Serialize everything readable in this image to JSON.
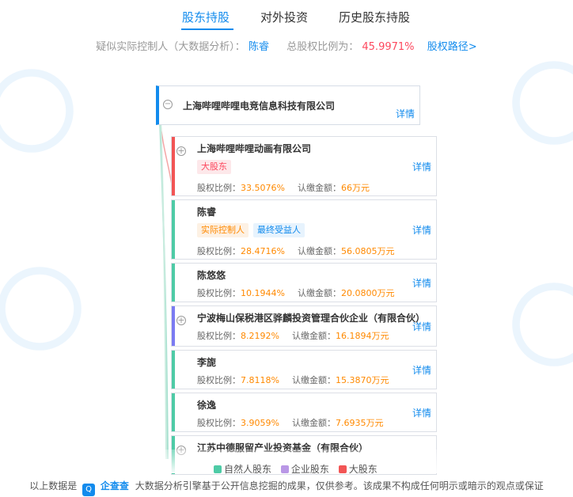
{
  "tabs": [
    {
      "label": "股东持股",
      "active": true
    },
    {
      "label": "对外投资",
      "active": false
    },
    {
      "label": "历史股东持股",
      "active": false
    }
  ],
  "summary": {
    "prefix": "疑似实际控制人（大数据分析）：",
    "controller": "陈睿",
    "ratio_label": "总股权比例为：",
    "ratio_value": "45.9971%",
    "path_label": "股权路径>"
  },
  "root": {
    "name": "上海哔哩哔哩电竞信息科技有限公司",
    "toggle": "−",
    "detail": "详情"
  },
  "labels": {
    "ratio": "股权比例：",
    "amount": "认缴金额：",
    "detail": "详情"
  },
  "shareholders": [
    {
      "name": "上海哔哩哔哩动画有限公司",
      "type": "big",
      "tags": [
        "大股东"
      ],
      "ratio": "33.5076%",
      "amount": "66万元",
      "toggle": "+"
    },
    {
      "name": "陈睿",
      "type": "natural",
      "tags": [
        "实际控制人",
        "最终受益人"
      ],
      "ratio": "28.4716%",
      "amount": "56.0805万元"
    },
    {
      "name": "陈悠悠",
      "type": "natural",
      "tags": [],
      "ratio": "10.1944%",
      "amount": "20.0800万元"
    },
    {
      "name": "宁波梅山保税港区骅麟投资管理合伙企业（有限合伙）",
      "type": "enterprise",
      "tags": [],
      "ratio": "8.2192%",
      "amount": "16.1894万元",
      "toggle": "+"
    },
    {
      "name": "李旎",
      "type": "natural",
      "tags": [],
      "ratio": "7.8118%",
      "amount": "15.3870万元"
    },
    {
      "name": "徐逸",
      "type": "natural",
      "tags": [],
      "ratio": "3.9059%",
      "amount": "7.6935万元"
    },
    {
      "name": "江苏中德服留产业投资基金（有限合伙）",
      "type": "natural",
      "tags": [],
      "ratio": "",
      "amount": "",
      "toggle": "+"
    }
  ],
  "legend": [
    {
      "label": "自然人股东",
      "color": "#4ecba6"
    },
    {
      "label": "企业股东",
      "color": "#b997e6"
    },
    {
      "label": "大股东",
      "color": "#f25555"
    }
  ],
  "colors": {
    "accent": "#128bed",
    "big": "#f25555",
    "natural": "#4ecba6",
    "enterprise": "#7b7bf2",
    "percent": "#fd485e",
    "value": "#ff8900"
  },
  "footer": {
    "prefix": "以上数据是",
    "logo_glyph": "Q",
    "brand": "企查查",
    "text": "大数据分析引擎基于公开信息挖掘的成果，仅供参考。该成果不构成任何明示或暗示的观点或保证"
  }
}
